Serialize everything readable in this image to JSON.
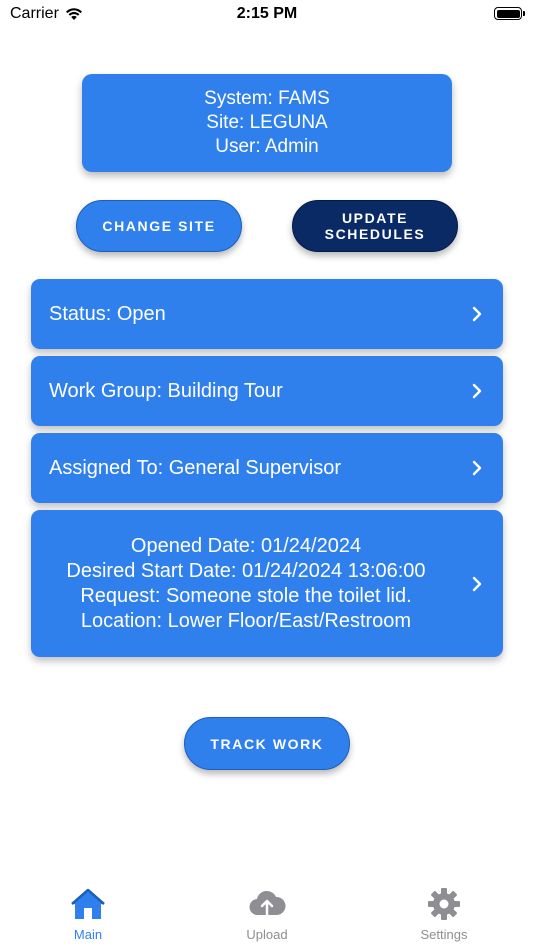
{
  "status_bar": {
    "carrier": "Carrier",
    "time": "2:15 PM",
    "icons": [
      "wifi-icon",
      "battery-icon"
    ]
  },
  "info": {
    "system": "System: FAMS",
    "site": "Site: LEGUNA",
    "user": "User: Admin"
  },
  "buttons": {
    "change_site": "CHANGE SITE",
    "update_schedules_line1": "UPDATE",
    "update_schedules_line2": "SCHEDULES",
    "track_work": "TRACK WORK"
  },
  "rows": {
    "status": "Status: Open",
    "work_group": "Work Group: Building Tour",
    "assigned_to": "Assigned To: General Supervisor"
  },
  "details": {
    "opened_date": "Opened Date: 01/24/2024",
    "desired_start": "Desired Start Date: 01/24/2024 13:06:00",
    "request": "Request: Someone stole the toilet lid.",
    "location": "Location: Lower Floor/East/Restroom"
  },
  "tabs": [
    {
      "label": "Main",
      "icon": "home-icon",
      "selected": true
    },
    {
      "label": "Upload",
      "icon": "cloud-upload-icon",
      "selected": false
    },
    {
      "label": "Settings",
      "icon": "gear-icon",
      "selected": false
    }
  ],
  "colors": {
    "accent": "#2f80ed",
    "dark_button": "#0a2a66",
    "inactive_tab": "#8e8e93"
  }
}
